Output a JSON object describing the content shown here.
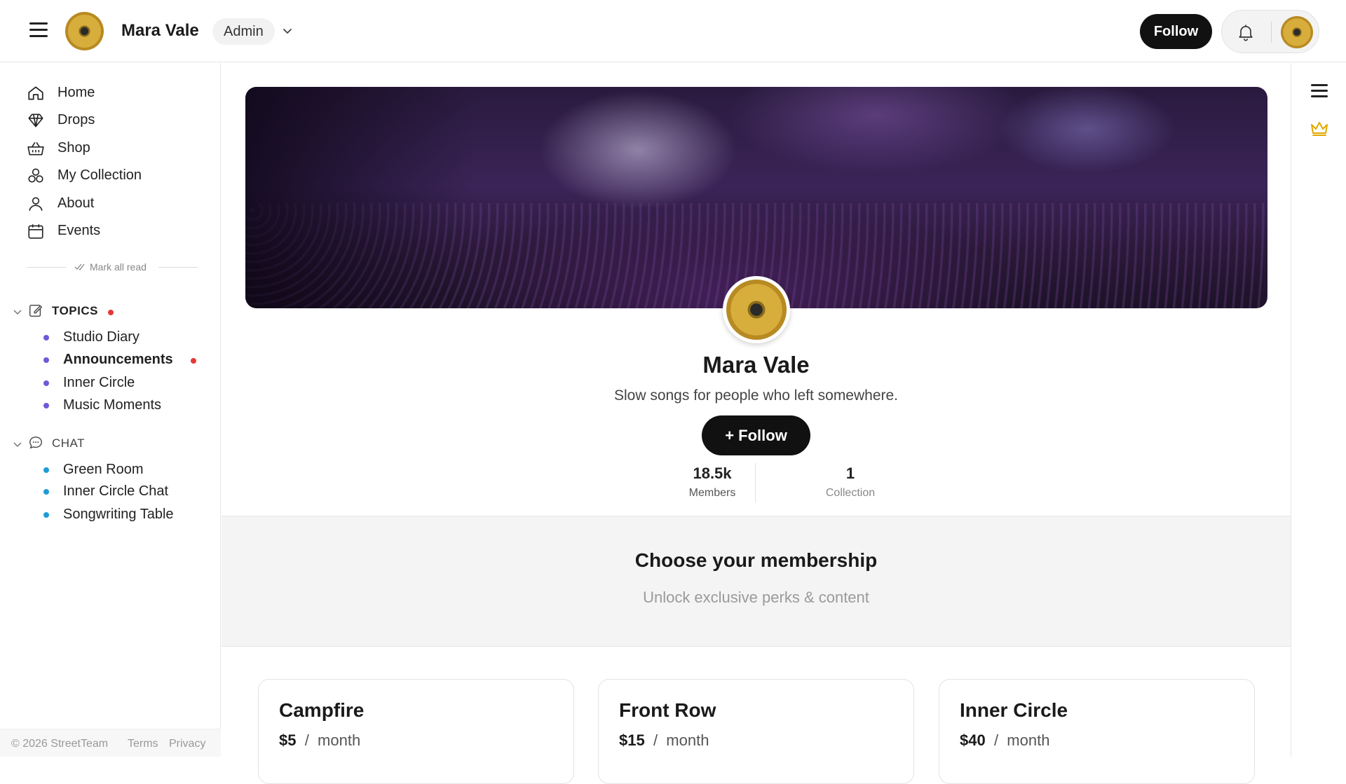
{
  "header": {
    "site_name": "Mara Vale",
    "role": "Admin",
    "follow_label": "Follow"
  },
  "sidebar": {
    "nav": [
      {
        "label": "Home",
        "icon": "home-icon"
      },
      {
        "label": "Drops",
        "icon": "diamond-icon"
      },
      {
        "label": "Shop",
        "icon": "basket-icon"
      },
      {
        "label": "My Collection",
        "icon": "collection-icon"
      },
      {
        "label": "About",
        "icon": "person-icon"
      },
      {
        "label": "Events",
        "icon": "calendar-icon"
      }
    ],
    "mark_all_read": "Mark all read",
    "topics": {
      "title": "TOPICS",
      "items": [
        {
          "label": "Studio Diary",
          "unread": false
        },
        {
          "label": "Announcements",
          "unread": true
        },
        {
          "label": "Inner Circle",
          "unread": false
        },
        {
          "label": "Music Moments",
          "unread": false
        }
      ]
    },
    "chat": {
      "title": "CHAT",
      "items": [
        {
          "label": "Green Room"
        },
        {
          "label": "Inner Circle Chat"
        },
        {
          "label": "Songwriting Table"
        }
      ]
    }
  },
  "footer": {
    "copyright": "© 2026 StreetTeam",
    "terms": "Terms",
    "privacy": "Privacy"
  },
  "profile": {
    "name": "Mara Vale",
    "tagline": "Slow songs for people who left somewhere.",
    "follow_label": "+ Follow",
    "stats": [
      {
        "value": "18.5k",
        "label": "Members"
      },
      {
        "value": "1",
        "label": "Collection"
      }
    ]
  },
  "membership": {
    "title": "Choose your membership",
    "subtitle": "Unlock exclusive perks & content",
    "tiers": [
      {
        "name": "Campfire",
        "price": "$5",
        "period": "month"
      },
      {
        "name": "Front Row",
        "price": "$15",
        "period": "month"
      },
      {
        "name": "Inner Circle",
        "price": "$40",
        "period": "month"
      }
    ]
  },
  "colors": {
    "topic_dot": "#6b5bd6",
    "chat_dot": "#1e9bd7",
    "unread_dot": "#e53935",
    "crown": "#e0a800"
  }
}
